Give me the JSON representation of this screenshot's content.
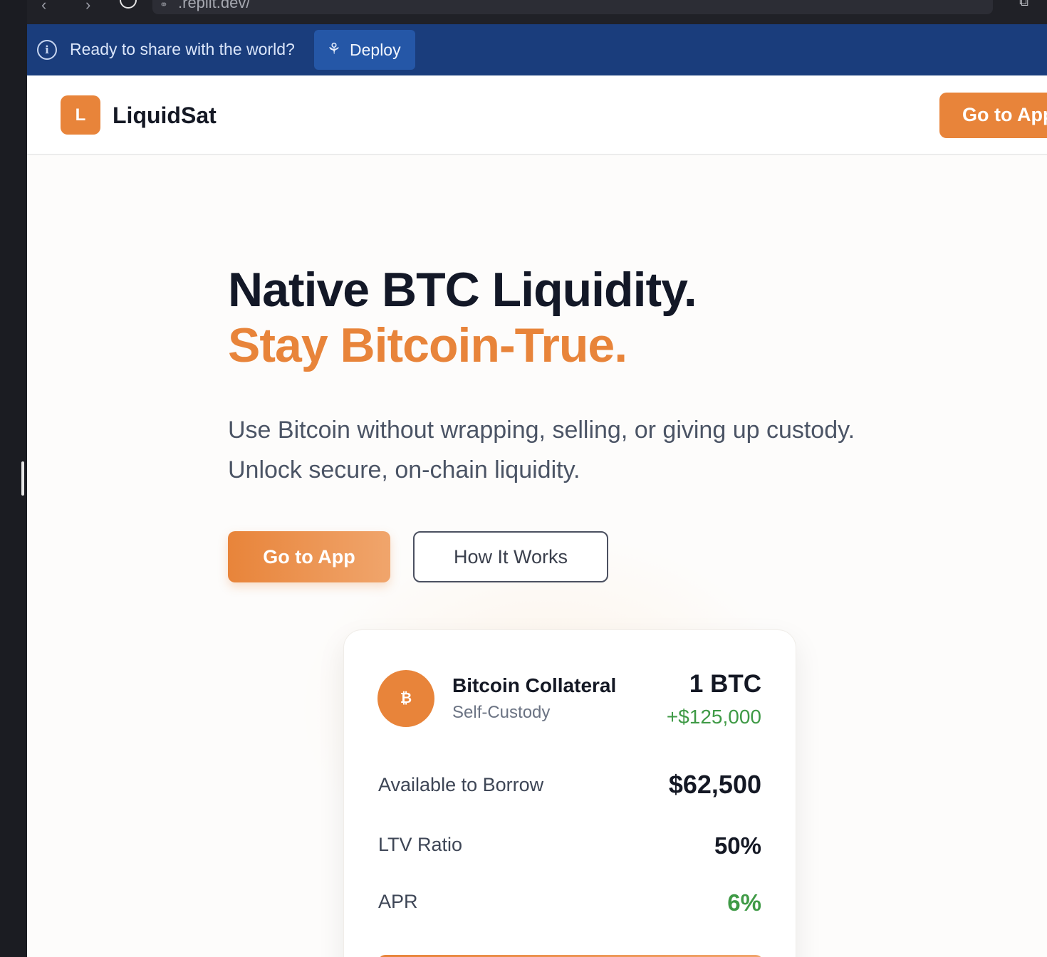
{
  "browser": {
    "url": ".replit.dev/"
  },
  "banner": {
    "message": "Ready to share with the world?",
    "deploy_label": "Deploy"
  },
  "header": {
    "logo_letter": "L",
    "brand": "LiquidSat",
    "cta_label": "Go to App"
  },
  "hero": {
    "title_line1": "Native BTC Liquidity.",
    "title_line2": "Stay Bitcoin-True.",
    "subtitle_line1": "Use Bitcoin without wrapping, selling, or giving up custody.",
    "subtitle_line2": "Unlock secure, on-chain liquidity.",
    "primary_cta": "Go to App",
    "secondary_cta": "How It Works"
  },
  "card": {
    "coin_symbol": "₿",
    "collateral_title": "Bitcoin Collateral",
    "collateral_subtitle": "Self-Custody",
    "btc_amount": "1 BTC",
    "usd_value": "+$125,000",
    "rows": [
      {
        "label": "Available to Borrow",
        "value": "$62,500"
      },
      {
        "label": "LTV Ratio",
        "value": "50%"
      },
      {
        "label": "APR",
        "value": "6%"
      }
    ]
  },
  "colors": {
    "accent": "#e8843a",
    "banner": "#1a3d7c",
    "positive": "#3f9a46",
    "text_dark": "#141824"
  }
}
